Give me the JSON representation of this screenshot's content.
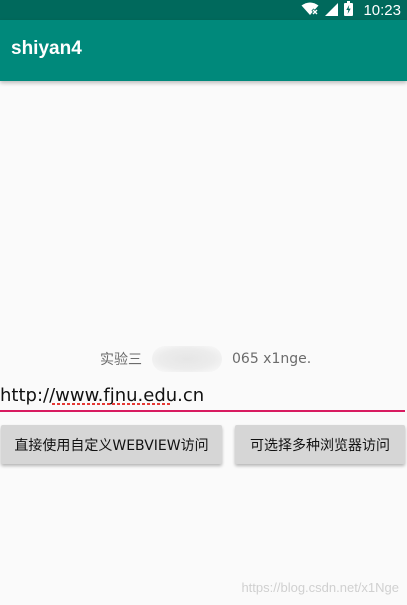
{
  "status_bar": {
    "time": "10:23",
    "icons": [
      "wifi-off-icon",
      "signal-icon",
      "battery-charging-icon"
    ]
  },
  "app_bar": {
    "title": "shiyan4"
  },
  "info": {
    "prefix": "实验三",
    "suffix": "065 x1nge."
  },
  "url_input": {
    "value": "http://www.fjnu.edu.cn"
  },
  "buttons": {
    "custom_webview": "直接使用自定义WEBVIEW访问",
    "choose_browser": "可选择多种浏览器访问"
  },
  "watermark": "https://blog.csdn.net/x1Nge",
  "colors": {
    "status_bar": "#00695c",
    "app_bar": "#00897b",
    "input_underline": "#d81b60",
    "button_bg": "#d6d6d6"
  }
}
